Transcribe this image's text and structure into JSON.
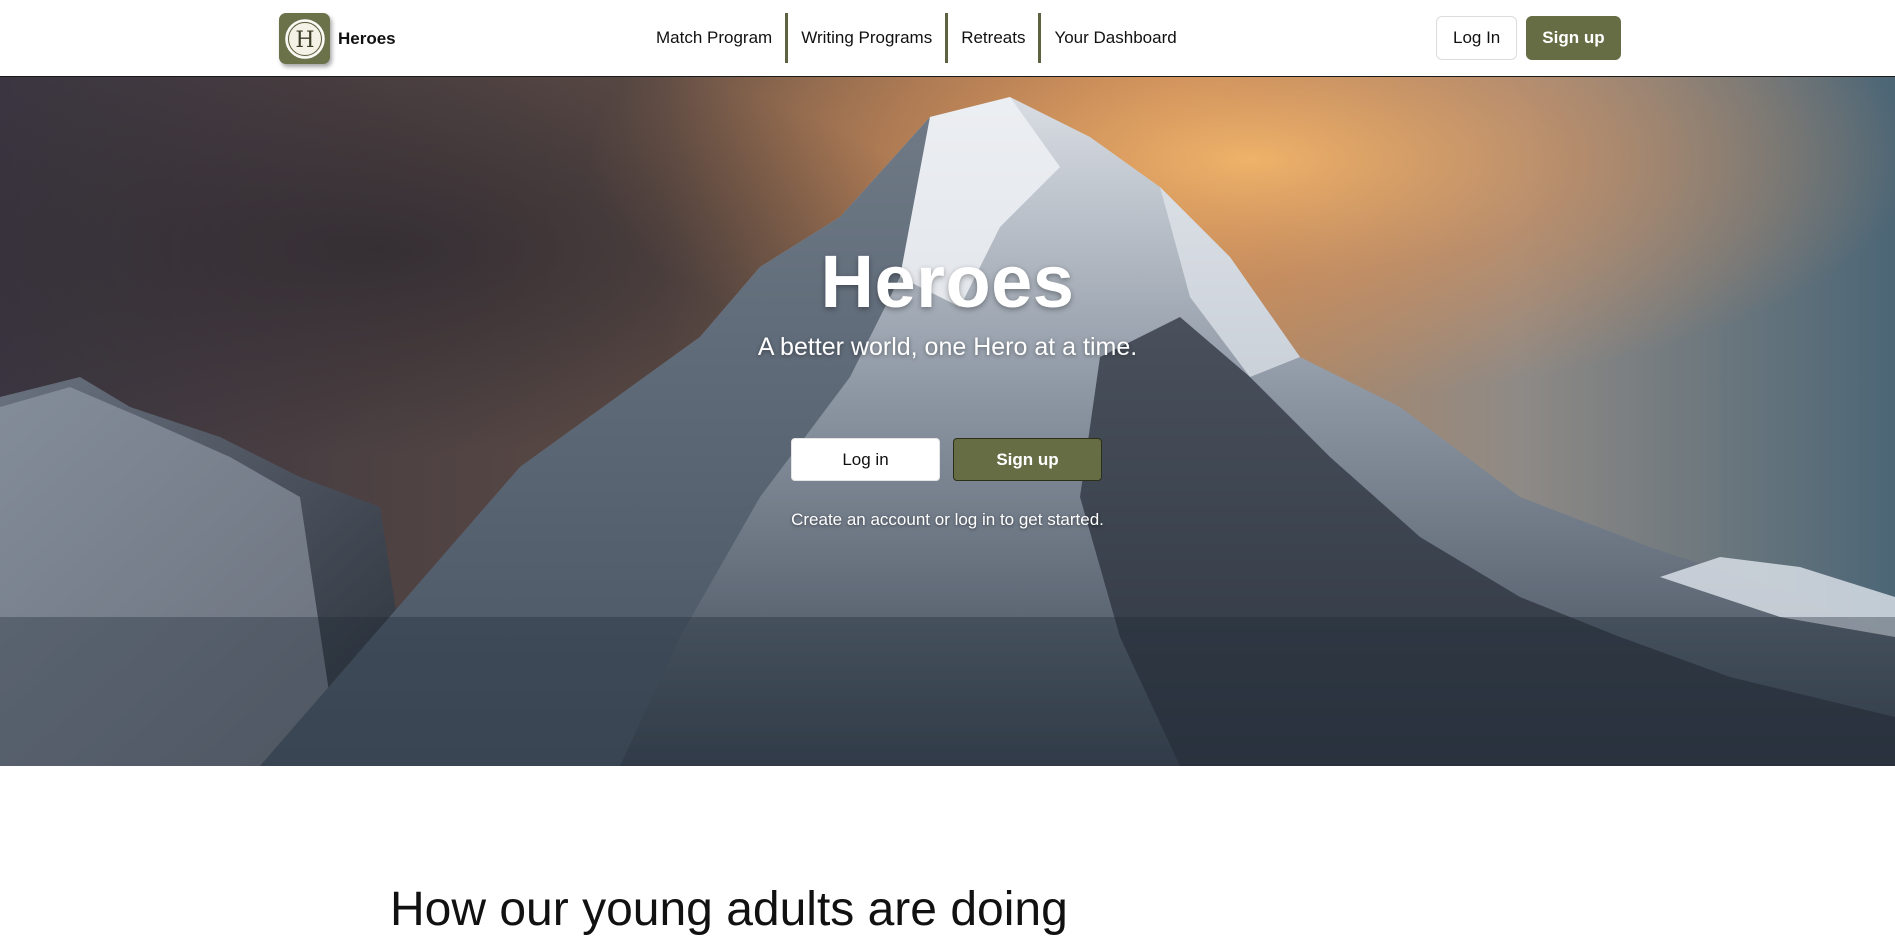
{
  "header": {
    "brand_name": "Heroes",
    "logo_letter": "H",
    "nav": [
      {
        "label": "Match Program"
      },
      {
        "label": "Writing Programs"
      },
      {
        "label": "Retreats"
      },
      {
        "label": "Your Dashboard"
      }
    ],
    "login_label": "Log In",
    "signup_label": "Sign up"
  },
  "hero": {
    "title": "Heroes",
    "subtitle": "A better world, one Hero at a time.",
    "login_label": "Log in",
    "signup_label": "Sign up",
    "note": "Create an account or log in to get started."
  },
  "section": {
    "heading": "How our young adults are doing"
  },
  "colors": {
    "brand_olive": "#666c43",
    "nav_separator": "#5d6240"
  }
}
